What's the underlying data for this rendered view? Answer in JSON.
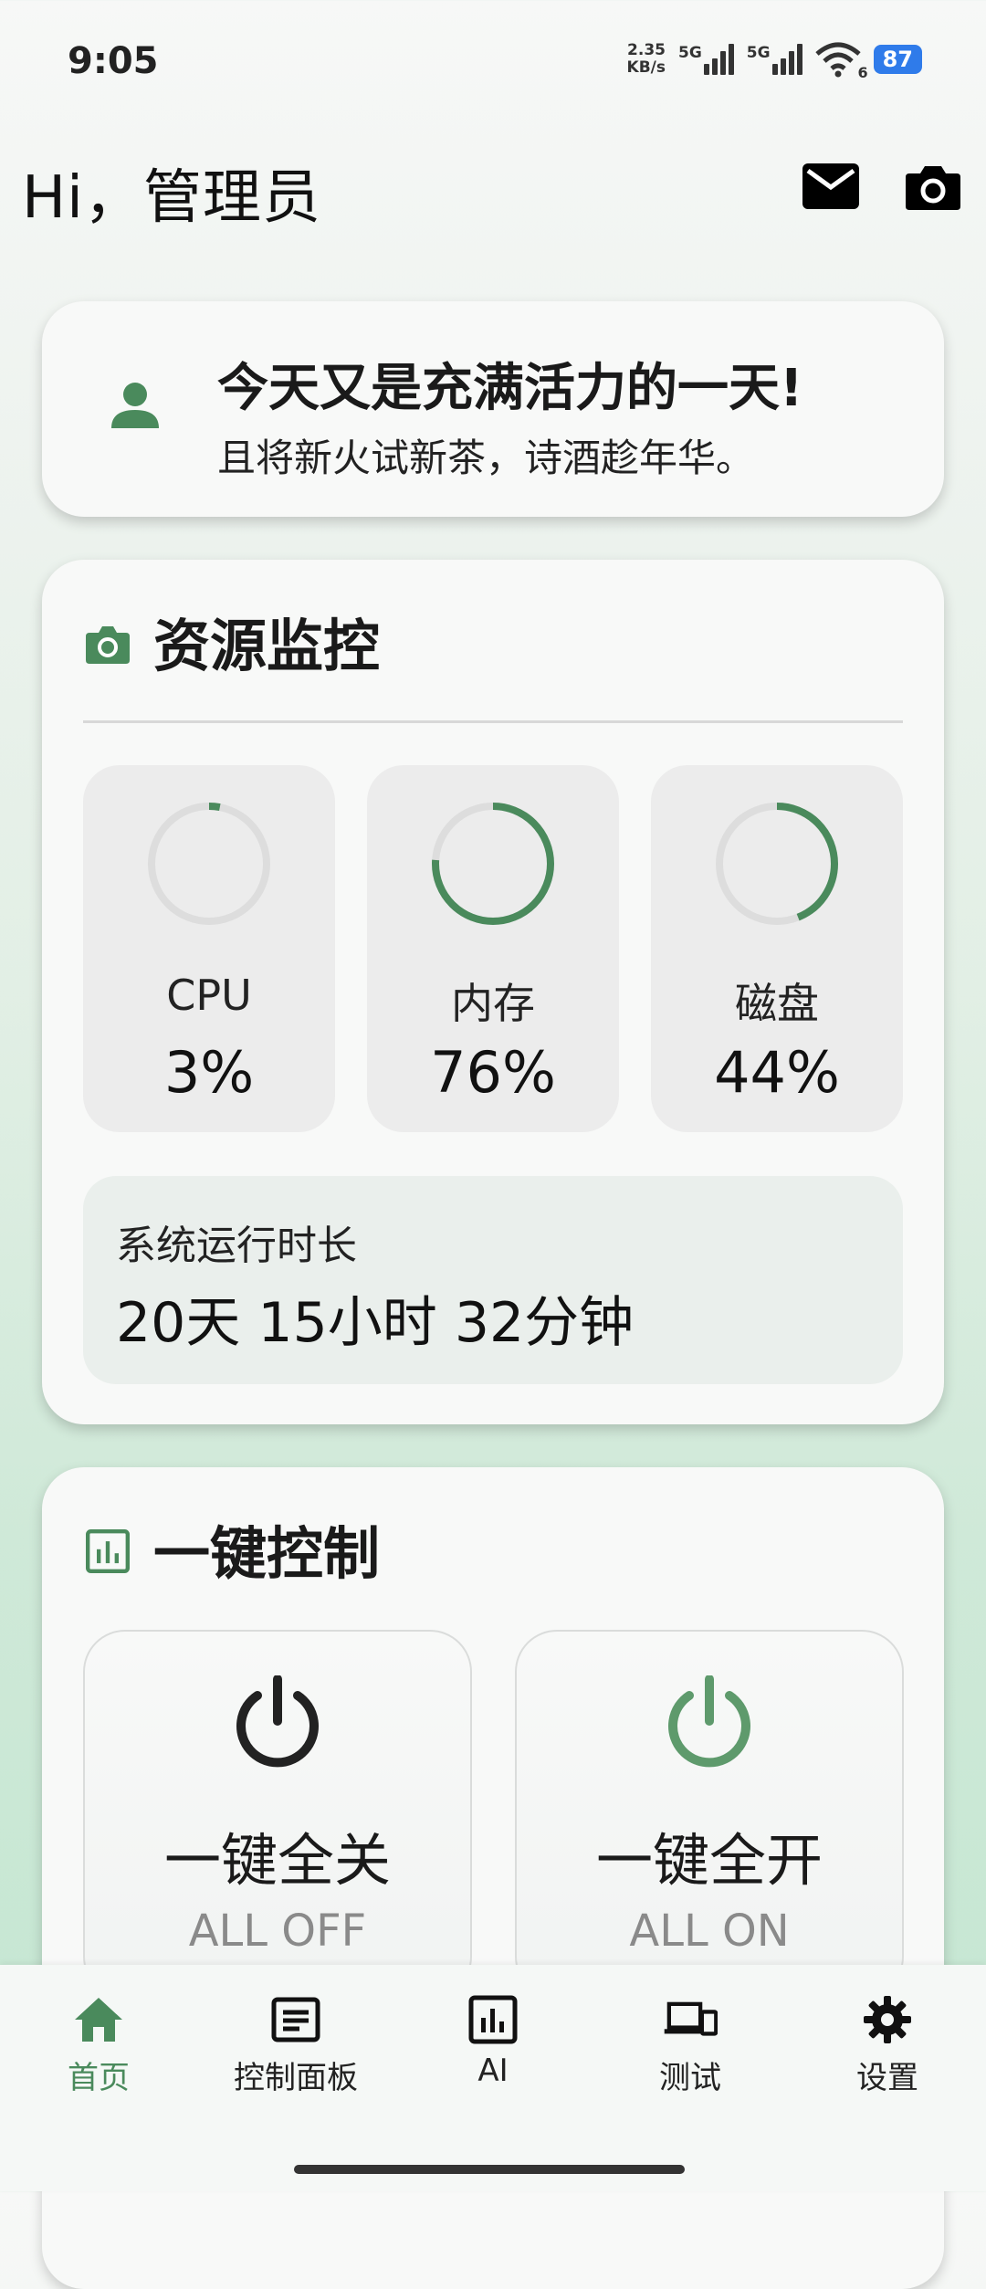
{
  "status_bar": {
    "time": "9:05",
    "net_speed_value": "2.35",
    "net_speed_unit": "KB/s",
    "sim1": "5G",
    "sim2": "5G",
    "wifi_label": "6",
    "battery": "87"
  },
  "header": {
    "greeting": "Hi，管理员",
    "mail_icon": "mail-icon",
    "camera_icon": "camera-icon"
  },
  "welcome": {
    "title": "今天又是充满活力的一天!",
    "subtitle": "且将新火试新茶，诗酒趁年华。"
  },
  "monitor": {
    "title": "资源监控",
    "gauges": [
      {
        "label": "CPU",
        "value_text": "3%",
        "percent": 3
      },
      {
        "label": "内存",
        "value_text": "76%",
        "percent": 76
      },
      {
        "label": "磁盘",
        "value_text": "44%",
        "percent": 44
      }
    ],
    "uptime_label": "系统运行时长",
    "uptime_value": "20天 15小时 32分钟"
  },
  "control": {
    "title": "一键控制",
    "all_off": {
      "label": "一键全关",
      "sub": "ALL OFF"
    },
    "all_on": {
      "label": "一键全开",
      "sub": "ALL ON"
    }
  },
  "nav": {
    "items": [
      {
        "label": "首页",
        "icon": "home-icon"
      },
      {
        "label": "控制面板",
        "icon": "article-icon"
      },
      {
        "label": "AI",
        "icon": "chart-icon"
      },
      {
        "label": "测试",
        "icon": "devices-icon"
      },
      {
        "label": "设置",
        "icon": "gear-icon"
      }
    ],
    "active_index": 0
  },
  "colors": {
    "accent": "#4a8a5c",
    "gauge_track": "#dddddd",
    "power_off": "#222222",
    "power_on": "#5e9a6c"
  }
}
